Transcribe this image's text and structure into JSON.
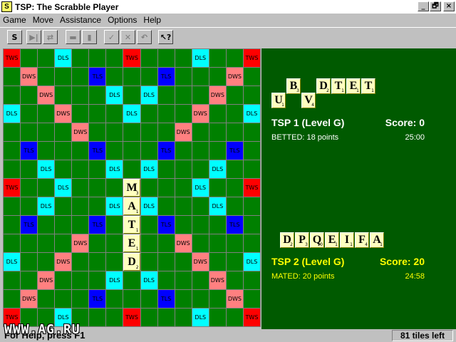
{
  "window": {
    "title": "TSP: The Scrabble Player",
    "icon_letter": "S",
    "controls": [
      "_",
      "🗗",
      "×"
    ]
  },
  "menu": [
    "Game",
    "Move",
    "Assistance",
    "Options",
    "Help"
  ],
  "toolbar": {
    "buttons": [
      {
        "name": "scrabble-icon-button",
        "glyph": "S",
        "enabled": true
      },
      {
        "name": "play-next-button",
        "glyph": "▶|",
        "enabled": false
      },
      {
        "name": "swap-tiles-button",
        "glyph": "⇄",
        "enabled": false
      },
      {
        "name": "pass-button",
        "glyph": "▬",
        "enabled": false
      },
      {
        "name": "column-button",
        "glyph": "▮",
        "enabled": false
      },
      {
        "name": "check-button",
        "glyph": "✓",
        "enabled": false
      },
      {
        "name": "cancel-button",
        "glyph": "✕",
        "enabled": false
      },
      {
        "name": "undo-button",
        "glyph": "↶",
        "enabled": false
      },
      {
        "name": "help-button",
        "glyph": "↖?",
        "enabled": true
      }
    ]
  },
  "board": {
    "labels": {
      "TW": "TWS",
      "DW": "DWS",
      "DL": "DLS",
      "TL": "TLS",
      "N": ""
    },
    "layout": [
      "TW N N DL N N N TW N N N DL N N TW",
      "N DW N N N TL N N N TL N N N DW N",
      "N N DW N N N DL N DL N N N DW N N",
      "DL N N DW N N N DL N N N DW N N DL",
      "N N N N DW N N N N N DW N N N N",
      "N TL N N N TL N N N TL N N N TL N",
      "N N DL N N N DL N DL N N N DL N N",
      "TW N N DL N N N DW N N N DL N N TW",
      "N N DL N N N DL N DL N N N DL N N",
      "N TL N N N TL N N N TL N N N TL N",
      "N N N N DW N N N N N DW N N N N",
      "DL N N DW N N N DL N N N DW N N DL",
      "N N DW N N N DL N DL N N N DW N N",
      "N DW N N N TL N N N TL N N N DW N",
      "TW N N DL N N N TW N N N DL N N TW"
    ],
    "placed_tiles": [
      {
        "row": 7,
        "col": 7,
        "letter": "M",
        "value": "3"
      },
      {
        "row": 8,
        "col": 7,
        "letter": "A",
        "value": "1"
      },
      {
        "row": 9,
        "col": 7,
        "letter": "T",
        "value": "1"
      },
      {
        "row": 10,
        "col": 7,
        "letter": "E",
        "value": "1"
      },
      {
        "row": 11,
        "col": 7,
        "letter": "D",
        "value": "2"
      }
    ]
  },
  "players": [
    {
      "name": "TSP 1 (Level G)",
      "score_label": "Score: 0",
      "last_move": "BETTED: 18 points",
      "time": "25:00",
      "color": "#ffffff",
      "rack": [
        {
          "letter": "U",
          "value": "1"
        },
        {
          "letter": "B",
          "value": "3"
        },
        {
          "letter": "V",
          "value": "4"
        },
        {
          "letter": "D",
          "value": "2"
        },
        {
          "letter": "T",
          "value": "1"
        },
        {
          "letter": "E",
          "value": "1"
        },
        {
          "letter": "T",
          "value": "1"
        }
      ]
    },
    {
      "name": "TSP 2 (Level G)",
      "score_label": "Score: 20",
      "last_move": "MATED: 20 points",
      "time": "24:58",
      "color": "#ffff00",
      "rack": [
        {
          "letter": "D",
          "value": "2"
        },
        {
          "letter": "P",
          "value": "3"
        },
        {
          "letter": "Q",
          "value": "10"
        },
        {
          "letter": "E",
          "value": "1"
        },
        {
          "letter": "I",
          "value": "1"
        },
        {
          "letter": "F",
          "value": "4"
        },
        {
          "letter": "A",
          "value": "1"
        }
      ]
    }
  ],
  "status": {
    "help_text": "For Help, press F1",
    "watermark": "WWW.AG.RU",
    "tiles_left": "81 tiles left"
  }
}
